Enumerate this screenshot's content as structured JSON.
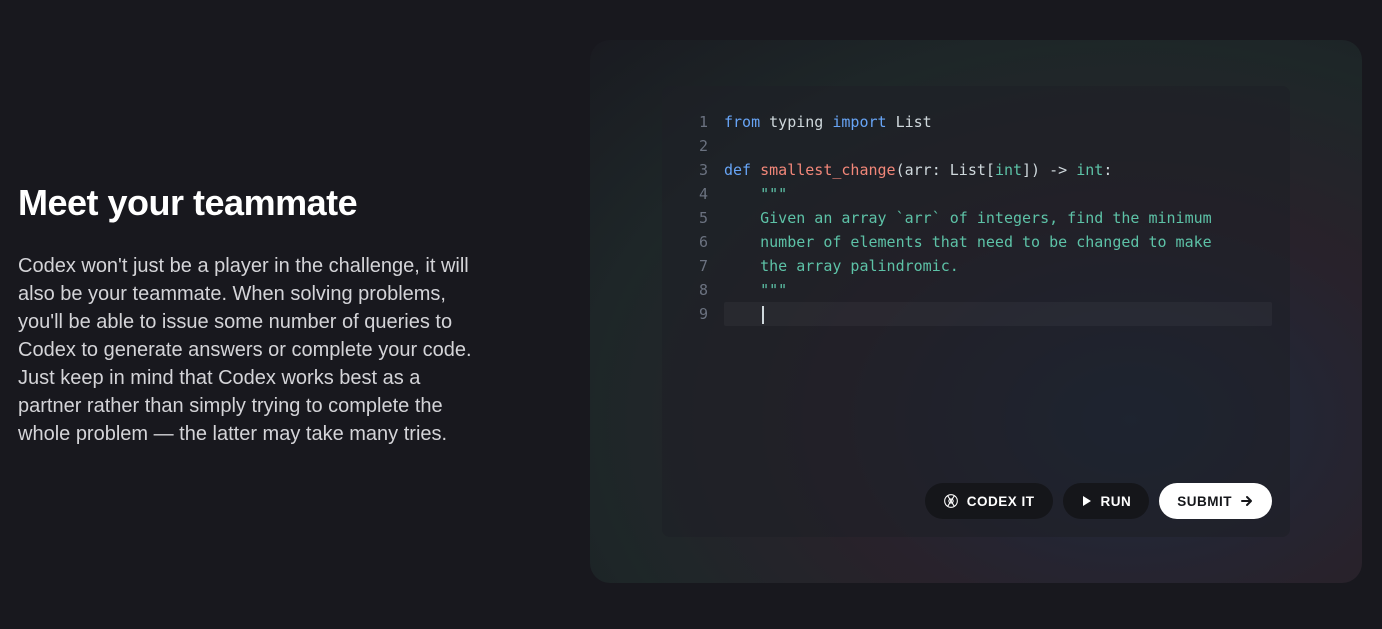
{
  "left": {
    "heading": "Meet your teammate",
    "body": "Codex won't just be a player in the challenge, it will also be your teammate. When solving problems, you'll be able to issue some number of queries to Codex to generate answers or complete your code. Just keep in mind that Codex works best as a partner rather than simply trying to complete the whole problem — the latter may take many tries."
  },
  "editor": {
    "lines": [
      {
        "num": "1",
        "segments": [
          {
            "t": "from",
            "c": "kw-import"
          },
          {
            "t": " typing ",
            "c": "plain"
          },
          {
            "t": "import",
            "c": "kw-import"
          },
          {
            "t": " List",
            "c": "plain"
          }
        ]
      },
      {
        "num": "2",
        "segments": []
      },
      {
        "num": "3",
        "segments": [
          {
            "t": "def",
            "c": "kw-def"
          },
          {
            "t": " ",
            "c": "plain"
          },
          {
            "t": "smallest_change",
            "c": "fn-name"
          },
          {
            "t": "(arr: List[",
            "c": "plain"
          },
          {
            "t": "int",
            "c": "type-int"
          },
          {
            "t": "]) -> ",
            "c": "plain"
          },
          {
            "t": "int",
            "c": "type-int"
          },
          {
            "t": ":",
            "c": "plain"
          }
        ]
      },
      {
        "num": "4",
        "segments": [
          {
            "t": "    \"\"\"",
            "c": "docstring"
          }
        ]
      },
      {
        "num": "5",
        "segments": [
          {
            "t": "    Given an array `arr` of integers, find the minimum",
            "c": "docstring"
          }
        ]
      },
      {
        "num": "6",
        "segments": [
          {
            "t": "    number of elements that need to be changed to make",
            "c": "docstring"
          }
        ]
      },
      {
        "num": "7",
        "segments": [
          {
            "t": "    the array palindromic.",
            "c": "docstring"
          }
        ]
      },
      {
        "num": "8",
        "segments": [
          {
            "t": "    \"\"\"",
            "c": "docstring"
          }
        ]
      },
      {
        "num": "9",
        "segments": [
          {
            "t": "    ",
            "c": "plain"
          }
        ],
        "active": true,
        "cursor": true
      }
    ]
  },
  "buttons": {
    "codex": "CODEX IT",
    "run": "RUN",
    "submit": "SUBMIT"
  },
  "colors": {
    "bg": "#18181e",
    "panel": "#1e1f26",
    "keyword": "#67a4f5",
    "function": "#f28779",
    "type": "#5dc2a7",
    "text": "#cfd8dc"
  }
}
